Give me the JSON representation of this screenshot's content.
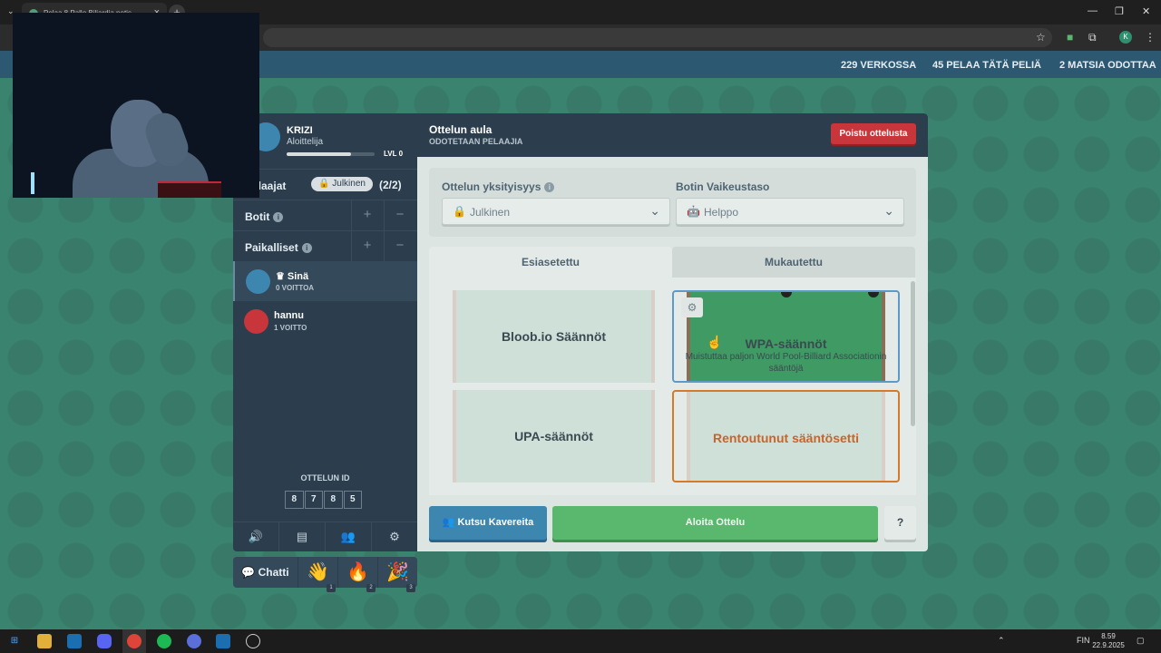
{
  "browser": {
    "tab_title": "Pelaa 8 Pallo Biljardia netis...",
    "tab_close": "×",
    "new_tab": "+",
    "search_tabs": "⌄",
    "window_controls": {
      "minimize": "—",
      "restore": "❐",
      "close": "✕"
    },
    "toolbar_icons": {
      "star": "☆",
      "extensions": "⧉",
      "menu": "⋮",
      "profile": "K"
    }
  },
  "site_header": {
    "online": "229 VERKOSSA",
    "playing": "45 PELAA TÄTÄ PELIÄ",
    "waiting": "2 MATSIA ODOTTAA"
  },
  "profile": {
    "name": "KRIZI",
    "rank": "Aloittelija",
    "level": "LVL 0",
    "xp_fraction": 0.73
  },
  "sidebar": {
    "players_label": "Pelaajat",
    "visibility_pill": "🔒 Julkinen",
    "player_count": "(2/2)",
    "bots_label": "Botit",
    "locals_label": "Paikalliset",
    "plus": "+",
    "minus": "−",
    "info": "i",
    "players": [
      {
        "name": "♛ Sinä",
        "wins": "0 VOITTOA",
        "avatar_color": "#3c86b0"
      },
      {
        "name": "hannu",
        "wins": "1 VOITTO",
        "avatar_color": "#c8353a"
      }
    ],
    "match_id_label": "OTTELUN ID",
    "match_id_digits": [
      "8",
      "7",
      "8",
      "5"
    ],
    "bottom_icons": [
      "🔊",
      "▤",
      "👥",
      "⚙"
    ]
  },
  "chat": {
    "label": "💬 Chatti",
    "emojis": [
      {
        "glyph": "👋",
        "key": "1"
      },
      {
        "glyph": "👋",
        "key": "1"
      },
      {
        "glyph": "🔥",
        "key": "2"
      },
      {
        "glyph": "🎉",
        "key": "3"
      }
    ]
  },
  "lobby": {
    "title": "Ottelun aula",
    "subtitle": "ODOTETAAN PELAAJIA",
    "leave_button": "Poistu ottelusta",
    "privacy_label": "Ottelun yksityisyys",
    "privacy_value": "Julkinen",
    "privacy_icon": "🔒",
    "bot_label": "Botin Vaikeustaso",
    "bot_value": "Helppo",
    "bot_icon": "🤖",
    "caret": "⌄",
    "tabs": [
      "Esiasetettu",
      "Mukautettu"
    ],
    "rules": [
      {
        "title": "Bloob.io Säännöt",
        "desc": ""
      },
      {
        "title": "WPA-säännöt",
        "desc": "Muistuttaa paljon World Pool-Billiard Associationin sääntöjä"
      },
      {
        "title": "UPA-säännöt",
        "desc": ""
      },
      {
        "title": "Rentoutunut sääntösetti",
        "desc": ""
      }
    ],
    "invite_button": "👥 Kutsu Kavereita",
    "start_button": "Aloita Ottelu",
    "help_button": "?"
  },
  "taskbar": {
    "language": "FIN",
    "time": "8.59",
    "date": "22.9.2025"
  },
  "colors": {
    "background": "#2f8f6f",
    "panel_dark": "#2c3e4d",
    "leave_red": "#c8353a",
    "start_green": "#5ab86e",
    "invite_blue": "#3c86b0",
    "selected_rule_border": "#5c9ac9",
    "relaxed_rule_orange": "#d47a2a"
  }
}
